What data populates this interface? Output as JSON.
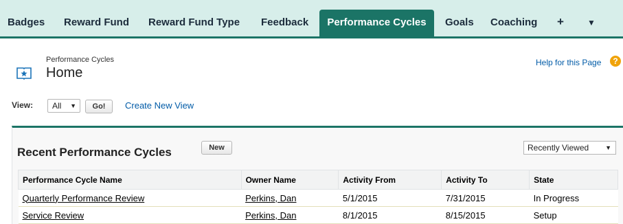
{
  "tabs": [
    {
      "label": "Badges",
      "name": "tab-badges"
    },
    {
      "label": "Reward Fund",
      "name": "tab-reward-fund"
    },
    {
      "label": "Reward Fund Type",
      "name": "tab-reward-fund-type"
    },
    {
      "label": "Feedback",
      "name": "tab-feedback"
    },
    {
      "label": "Performance Cycles",
      "name": "tab-performance-cycles",
      "active": true
    },
    {
      "label": "Goals",
      "name": "tab-goals"
    },
    {
      "label": "Coaching",
      "name": "tab-coaching"
    }
  ],
  "tab_icons": {
    "plus": "+",
    "chevron": "▼"
  },
  "header": {
    "subtitle": "Performance Cycles",
    "title": "Home",
    "help_link": "Help for this Page",
    "help_icon": "?"
  },
  "view": {
    "label": "View:",
    "selected": "All",
    "go_label": "Go!",
    "create_link": "Create New View"
  },
  "recent": {
    "title": "Recent Performance Cycles",
    "new_label": "New",
    "filter_selected": "Recently Viewed",
    "columns": [
      "Performance Cycle Name",
      "Owner Name",
      "Activity From",
      "Activity To",
      "State"
    ],
    "rows": [
      [
        "Quarterly Performance Review",
        "Perkins, Dan",
        "5/1/2015",
        "7/31/2015",
        "In Progress"
      ],
      [
        "Service Review",
        "Perkins, Dan",
        "8/1/2015",
        "8/15/2015",
        "Setup"
      ]
    ]
  },
  "colors": {
    "accent": "#1b7466",
    "tabbar_bg": "#d7eeea",
    "link": "#015ba7",
    "help_icon": "#f0a30a"
  }
}
